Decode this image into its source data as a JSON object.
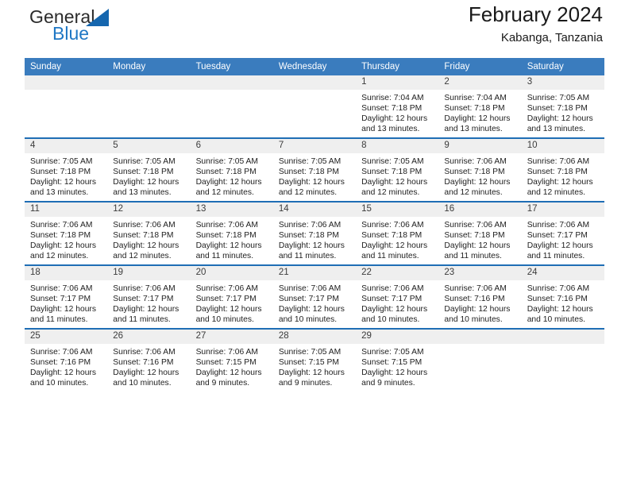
{
  "brand": {
    "name_part1": "General",
    "name_part2": "Blue",
    "triangle_color": "#1566ae",
    "accent_color": "#1f77c4"
  },
  "header": {
    "title": "February 2024",
    "subtitle": "Kabanga, Tanzania"
  },
  "theme": {
    "header_row_bg": "#3a7cbe",
    "daynum_bg": "#efefef",
    "row_divider": "#1f6eb5"
  },
  "weekdays": [
    "Sunday",
    "Monday",
    "Tuesday",
    "Wednesday",
    "Thursday",
    "Friday",
    "Saturday"
  ],
  "weeks": [
    [
      {
        "day": "",
        "empty": true,
        "lines": []
      },
      {
        "day": "",
        "empty": true,
        "lines": []
      },
      {
        "day": "",
        "empty": true,
        "lines": []
      },
      {
        "day": "",
        "empty": true,
        "lines": []
      },
      {
        "day": "1",
        "empty": false,
        "lines": [
          "Sunrise: 7:04 AM",
          "Sunset: 7:18 PM",
          "Daylight: 12 hours",
          "and 13 minutes."
        ]
      },
      {
        "day": "2",
        "empty": false,
        "lines": [
          "Sunrise: 7:04 AM",
          "Sunset: 7:18 PM",
          "Daylight: 12 hours",
          "and 13 minutes."
        ]
      },
      {
        "day": "3",
        "empty": false,
        "lines": [
          "Sunrise: 7:05 AM",
          "Sunset: 7:18 PM",
          "Daylight: 12 hours",
          "and 13 minutes."
        ]
      }
    ],
    [
      {
        "day": "4",
        "empty": false,
        "lines": [
          "Sunrise: 7:05 AM",
          "Sunset: 7:18 PM",
          "Daylight: 12 hours",
          "and 13 minutes."
        ]
      },
      {
        "day": "5",
        "empty": false,
        "lines": [
          "Sunrise: 7:05 AM",
          "Sunset: 7:18 PM",
          "Daylight: 12 hours",
          "and 13 minutes."
        ]
      },
      {
        "day": "6",
        "empty": false,
        "lines": [
          "Sunrise: 7:05 AM",
          "Sunset: 7:18 PM",
          "Daylight: 12 hours",
          "and 12 minutes."
        ]
      },
      {
        "day": "7",
        "empty": false,
        "lines": [
          "Sunrise: 7:05 AM",
          "Sunset: 7:18 PM",
          "Daylight: 12 hours",
          "and 12 minutes."
        ]
      },
      {
        "day": "8",
        "empty": false,
        "lines": [
          "Sunrise: 7:05 AM",
          "Sunset: 7:18 PM",
          "Daylight: 12 hours",
          "and 12 minutes."
        ]
      },
      {
        "day": "9",
        "empty": false,
        "lines": [
          "Sunrise: 7:06 AM",
          "Sunset: 7:18 PM",
          "Daylight: 12 hours",
          "and 12 minutes."
        ]
      },
      {
        "day": "10",
        "empty": false,
        "lines": [
          "Sunrise: 7:06 AM",
          "Sunset: 7:18 PM",
          "Daylight: 12 hours",
          "and 12 minutes."
        ]
      }
    ],
    [
      {
        "day": "11",
        "empty": false,
        "lines": [
          "Sunrise: 7:06 AM",
          "Sunset: 7:18 PM",
          "Daylight: 12 hours",
          "and 12 minutes."
        ]
      },
      {
        "day": "12",
        "empty": false,
        "lines": [
          "Sunrise: 7:06 AM",
          "Sunset: 7:18 PM",
          "Daylight: 12 hours",
          "and 12 minutes."
        ]
      },
      {
        "day": "13",
        "empty": false,
        "lines": [
          "Sunrise: 7:06 AM",
          "Sunset: 7:18 PM",
          "Daylight: 12 hours",
          "and 11 minutes."
        ]
      },
      {
        "day": "14",
        "empty": false,
        "lines": [
          "Sunrise: 7:06 AM",
          "Sunset: 7:18 PM",
          "Daylight: 12 hours",
          "and 11 minutes."
        ]
      },
      {
        "day": "15",
        "empty": false,
        "lines": [
          "Sunrise: 7:06 AM",
          "Sunset: 7:18 PM",
          "Daylight: 12 hours",
          "and 11 minutes."
        ]
      },
      {
        "day": "16",
        "empty": false,
        "lines": [
          "Sunrise: 7:06 AM",
          "Sunset: 7:18 PM",
          "Daylight: 12 hours",
          "and 11 minutes."
        ]
      },
      {
        "day": "17",
        "empty": false,
        "lines": [
          "Sunrise: 7:06 AM",
          "Sunset: 7:17 PM",
          "Daylight: 12 hours",
          "and 11 minutes."
        ]
      }
    ],
    [
      {
        "day": "18",
        "empty": false,
        "lines": [
          "Sunrise: 7:06 AM",
          "Sunset: 7:17 PM",
          "Daylight: 12 hours",
          "and 11 minutes."
        ]
      },
      {
        "day": "19",
        "empty": false,
        "lines": [
          "Sunrise: 7:06 AM",
          "Sunset: 7:17 PM",
          "Daylight: 12 hours",
          "and 11 minutes."
        ]
      },
      {
        "day": "20",
        "empty": false,
        "lines": [
          "Sunrise: 7:06 AM",
          "Sunset: 7:17 PM",
          "Daylight: 12 hours",
          "and 10 minutes."
        ]
      },
      {
        "day": "21",
        "empty": false,
        "lines": [
          "Sunrise: 7:06 AM",
          "Sunset: 7:17 PM",
          "Daylight: 12 hours",
          "and 10 minutes."
        ]
      },
      {
        "day": "22",
        "empty": false,
        "lines": [
          "Sunrise: 7:06 AM",
          "Sunset: 7:17 PM",
          "Daylight: 12 hours",
          "and 10 minutes."
        ]
      },
      {
        "day": "23",
        "empty": false,
        "lines": [
          "Sunrise: 7:06 AM",
          "Sunset: 7:16 PM",
          "Daylight: 12 hours",
          "and 10 minutes."
        ]
      },
      {
        "day": "24",
        "empty": false,
        "lines": [
          "Sunrise: 7:06 AM",
          "Sunset: 7:16 PM",
          "Daylight: 12 hours",
          "and 10 minutes."
        ]
      }
    ],
    [
      {
        "day": "25",
        "empty": false,
        "lines": [
          "Sunrise: 7:06 AM",
          "Sunset: 7:16 PM",
          "Daylight: 12 hours",
          "and 10 minutes."
        ]
      },
      {
        "day": "26",
        "empty": false,
        "lines": [
          "Sunrise: 7:06 AM",
          "Sunset: 7:16 PM",
          "Daylight: 12 hours",
          "and 10 minutes."
        ]
      },
      {
        "day": "27",
        "empty": false,
        "lines": [
          "Sunrise: 7:06 AM",
          "Sunset: 7:15 PM",
          "Daylight: 12 hours",
          "and 9 minutes."
        ]
      },
      {
        "day": "28",
        "empty": false,
        "lines": [
          "Sunrise: 7:05 AM",
          "Sunset: 7:15 PM",
          "Daylight: 12 hours",
          "and 9 minutes."
        ]
      },
      {
        "day": "29",
        "empty": false,
        "lines": [
          "Sunrise: 7:05 AM",
          "Sunset: 7:15 PM",
          "Daylight: 12 hours",
          "and 9 minutes."
        ]
      },
      {
        "day": "",
        "empty": true,
        "lines": []
      },
      {
        "day": "",
        "empty": true,
        "lines": []
      }
    ]
  ]
}
